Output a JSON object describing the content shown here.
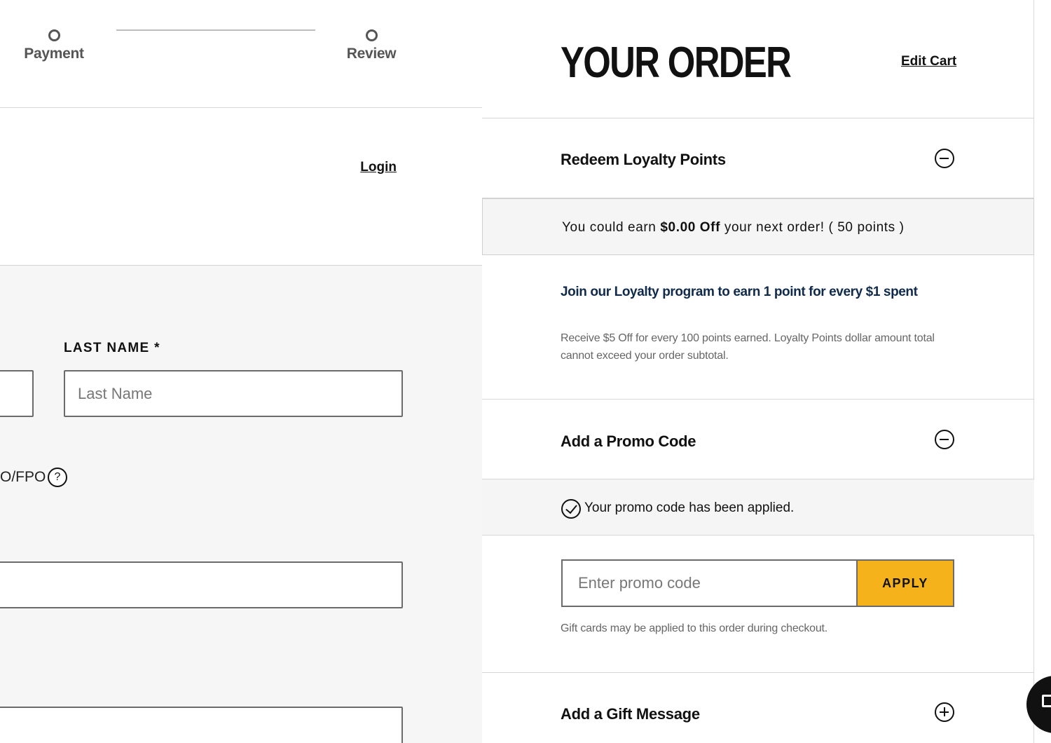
{
  "stepper": {
    "steps": [
      {
        "label": "Payment"
      },
      {
        "label": "Review"
      }
    ]
  },
  "account": {
    "login_label": "Login"
  },
  "shipping_form": {
    "last_name_label": "LAST NAME *",
    "last_name_placeholder": "Last Name",
    "apo_text": "O/FPO",
    "help_glyph": "?"
  },
  "order": {
    "title": "YOUR ORDER",
    "edit_cart_label": "Edit Cart",
    "loyalty": {
      "title": "Redeem Loyalty Points",
      "toggle_icon": "minus-circle-icon",
      "earn_prefix": "You could earn ",
      "earn_amount": "$0.00 Off",
      "earn_suffix": " your next order! ( 50 points )",
      "join_text": "Join our Loyalty program to earn 1 point for every $1 spent",
      "receive_text": "Receive $5 Off for every 100 points earned. Loyalty Points dollar amount total cannot exceed your order subtotal."
    },
    "promo": {
      "title": "Add a Promo Code",
      "toggle_icon": "minus-circle-icon",
      "applied_text": "Your promo code has been applied.",
      "input_placeholder": "Enter promo code",
      "apply_label": "APPLY",
      "gift_card_note": "Gift cards may be applied to this order during checkout."
    },
    "gift_message": {
      "title": "Add a Gift Message",
      "toggle_icon": "plus-circle-icon"
    }
  },
  "colors": {
    "accent": "#f5b21b",
    "link_navy": "#0f2a4a",
    "panel_gray": "#f6f6f6"
  }
}
